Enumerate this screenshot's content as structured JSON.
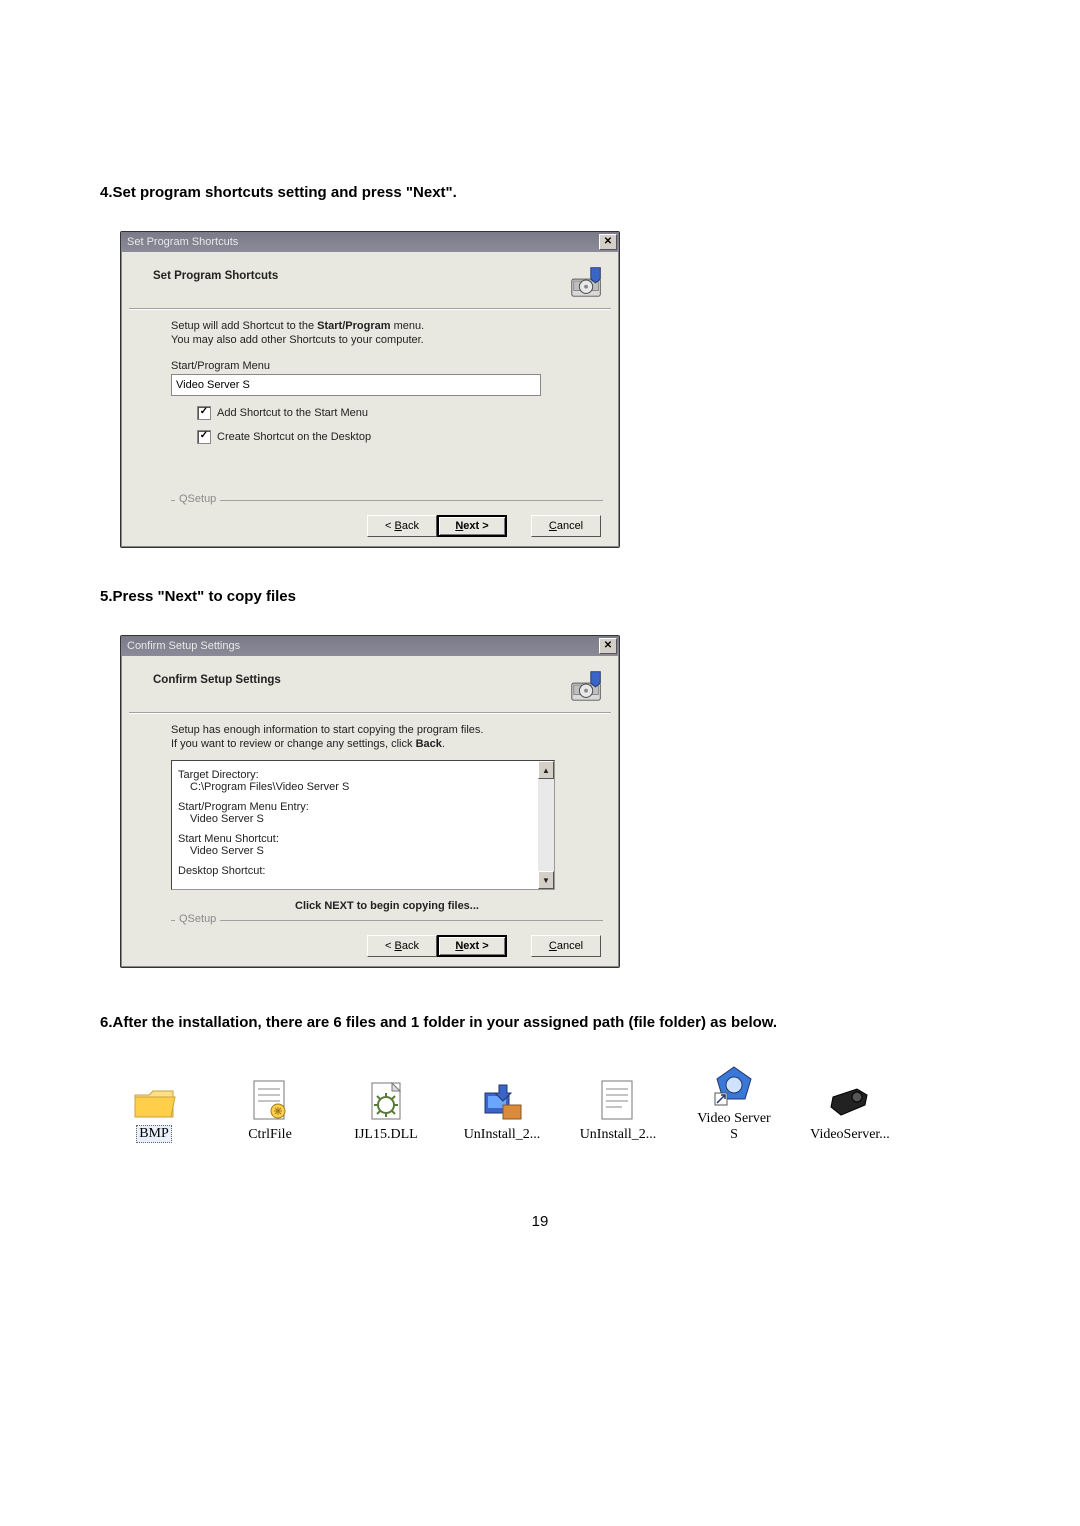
{
  "step4": {
    "heading": "4.Set program shortcuts setting and  press \"Next\".",
    "title": "Set Program Shortcuts",
    "header_title": "Set Program Shortcuts",
    "body_line1a": "Setup will add Shortcut to the ",
    "body_line1b": "Start/Program",
    "body_line1c": " menu.",
    "body_line2": "You may also add other Shortcuts to your computer.",
    "input_label": "Start/Program Menu",
    "input_value": "Video Server S",
    "chk1": "Add Shortcut to the Start Menu",
    "chk2": "Create Shortcut on the Desktop",
    "qsetup": "QSetup",
    "back_label_pre": "< ",
    "back_label_u": "B",
    "back_label_post": "ack",
    "next_label_u": "N",
    "next_label_post": "ext >",
    "cancel_label_u": "C",
    "cancel_label_post": "ancel"
  },
  "step5": {
    "heading": "5.Press \"Next\" to copy files",
    "title": "Confirm Setup Settings",
    "header_title": "Confirm Setup Settings",
    "body_line1": "Setup has enough information to start copying the program files.",
    "body_line2a": "If you want to review or change any settings, click ",
    "body_line2b": "Back",
    "body_line2c": ".",
    "list_l1": "Target Directory:",
    "list_v1": "C:\\Program Files\\Video Server S",
    "list_l2": "Start/Program Menu Entry:",
    "list_v2": "Video Server S",
    "list_l3": "Start Menu Shortcut:",
    "list_v3": "Video Server S",
    "list_l4": "Desktop Shortcut:",
    "click_next": "Click NEXT to begin copying files...",
    "qsetup": "QSetup"
  },
  "step6": {
    "heading": "6.After the installation, there are 6 files and 1 folder in your assigned path (file folder) as below."
  },
  "files": [
    {
      "name": "BMP"
    },
    {
      "name": "CtrlFile"
    },
    {
      "name": "IJL15.DLL"
    },
    {
      "name": "UnInstall_2..."
    },
    {
      "name": "UnInstall_2..."
    },
    {
      "name": "Video Server S"
    },
    {
      "name": "VideoServer..."
    }
  ],
  "page_number": "19"
}
